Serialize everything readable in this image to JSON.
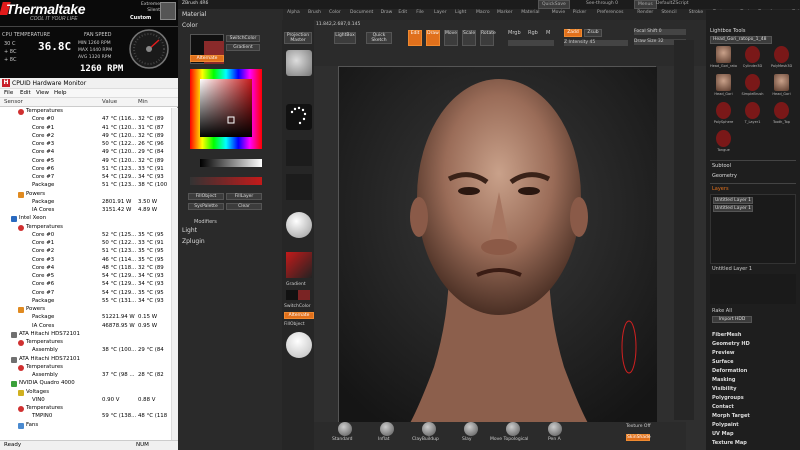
{
  "thermaltake": {
    "brand": "Thermaltake",
    "tagline": "COOL IT YOUR LIFE",
    "profile_line1": "Extreme",
    "profile_line2": "Silent",
    "profile_current": "Custom",
    "cpu_label": "CPU TEMPERATURE",
    "fan_label": "FAN SPEED",
    "cpu_temp": "36.8C",
    "row1": "30 C",
    "row2": "+ 8C",
    "row3": "+ 8C",
    "fan_min": "MIN   1260 RPM",
    "fan_max": "MAX   1440 RPM",
    "fan_avg": "AVG   1320 RPM",
    "rpm": "1260 RPM"
  },
  "hwmonitor": {
    "title": "CPUID Hardware Monitor",
    "menu": [
      "File",
      "Edit",
      "View",
      "Help"
    ],
    "headers": {
      "sensor": "Sensor",
      "value": "Value",
      "min": "Min"
    },
    "rows": [
      {
        "label": "Temperatures",
        "value": "",
        "min": "",
        "indent": 2,
        "icon": "thermometer"
      },
      {
        "label": "Core #0",
        "value": "47 °C (116...",
        "min": "32 °C (89",
        "indent": 4
      },
      {
        "label": "Core #1",
        "value": "41 °C (120...",
        "min": "31 °C (87",
        "indent": 4
      },
      {
        "label": "Core #2",
        "value": "49 °C (120...",
        "min": "32 °C (89",
        "indent": 4
      },
      {
        "label": "Core #3",
        "value": "50 °C (122...",
        "min": "26 °C (96",
        "indent": 4
      },
      {
        "label": "Core #4",
        "value": "49 °C (120...",
        "min": "29 °C (84",
        "indent": 4
      },
      {
        "label": "Core #5",
        "value": "49 °C (120...",
        "min": "32 °C (89",
        "indent": 4
      },
      {
        "label": "Core #6",
        "value": "51 °C (123...",
        "min": "33 °C (91",
        "indent": 4
      },
      {
        "label": "Core #7",
        "value": "54 °C (129...",
        "min": "34 °C (93",
        "indent": 4
      },
      {
        "label": "Package",
        "value": "51 °C (123...",
        "min": "38 °C (100",
        "indent": 4
      },
      {
        "label": "Powers",
        "value": "",
        "min": "",
        "indent": 2,
        "icon": "flame"
      },
      {
        "label": "Package",
        "value": "2801.91 W",
        "min": "3.50 W",
        "indent": 4
      },
      {
        "label": "IA Cores",
        "value": "3151.42 W",
        "min": "4.89 W",
        "indent": 4
      },
      {
        "label": "Intel Xeon",
        "value": "",
        "min": "",
        "indent": 1,
        "icon": "chip"
      },
      {
        "label": "Temperatures",
        "value": "",
        "min": "",
        "indent": 2,
        "icon": "thermometer"
      },
      {
        "label": "Core #0",
        "value": "52 °C (125...",
        "min": "35 °C (95",
        "indent": 4
      },
      {
        "label": "Core #1",
        "value": "50 °C (122...",
        "min": "33 °C (91",
        "indent": 4
      },
      {
        "label": "Core #2",
        "value": "51 °C (123...",
        "min": "35 °C (95",
        "indent": 4
      },
      {
        "label": "Core #3",
        "value": "46 °C (114...",
        "min": "35 °C (95",
        "indent": 4
      },
      {
        "label": "Core #4",
        "value": "48 °C (118...",
        "min": "32 °C (89",
        "indent": 4
      },
      {
        "label": "Core #5",
        "value": "54 °C (129...",
        "min": "34 °C (93",
        "indent": 4
      },
      {
        "label": "Core #6",
        "value": "54 °C (129...",
        "min": "34 °C (93",
        "indent": 4
      },
      {
        "label": "Core #7",
        "value": "54 °C (129...",
        "min": "35 °C (95",
        "indent": 4
      },
      {
        "label": "Package",
        "value": "55 °C (131...",
        "min": "34 °C (93",
        "indent": 4
      },
      {
        "label": "Powers",
        "value": "",
        "min": "",
        "indent": 2,
        "icon": "flame"
      },
      {
        "label": "Package",
        "value": "51221.94 W",
        "min": "0.15 W",
        "indent": 4
      },
      {
        "label": "IA Cores",
        "value": "46878.95 W",
        "min": "0.95 W",
        "indent": 4
      },
      {
        "label": "ATA Hitachi HDS72101",
        "value": "",
        "min": "",
        "indent": 1,
        "icon": "disk"
      },
      {
        "label": "Temperatures",
        "value": "",
        "min": "",
        "indent": 2,
        "icon": "thermometer"
      },
      {
        "label": "Assembly",
        "value": "38 °C (100...",
        "min": "29 °C (84",
        "indent": 4
      },
      {
        "label": "ATA Hitachi HDS72101",
        "value": "",
        "min": "",
        "indent": 1,
        "icon": "disk"
      },
      {
        "label": "Temperatures",
        "value": "",
        "min": "",
        "indent": 2,
        "icon": "thermometer"
      },
      {
        "label": "Assembly",
        "value": "37 °C (98 ...",
        "min": "28 °C (82",
        "indent": 4
      },
      {
        "label": "NVIDIA Quadro 4000",
        "value": "",
        "min": "",
        "indent": 1,
        "icon": "gpu"
      },
      {
        "label": "Voltages",
        "value": "",
        "min": "",
        "indent": 2,
        "icon": "voltage"
      },
      {
        "label": "VIN0",
        "value": "0.90 V",
        "min": "0.88 V",
        "indent": 4
      },
      {
        "label": "Temperatures",
        "value": "",
        "min": "",
        "indent": 2,
        "icon": "thermometer"
      },
      {
        "label": "TMPIN0",
        "value": "59 °C (138...",
        "min": "48 °C (118",
        "indent": 4
      },
      {
        "label": "Fans",
        "value": "",
        "min": "",
        "indent": 2,
        "icon": "fan"
      }
    ],
    "status_ready": "Ready",
    "status_num": "NUM"
  },
  "zbrush": {
    "title": "ZBrush 4R6",
    "menu": [
      "Alpha",
      "Brush",
      "Color",
      "Document",
      "Draw",
      "Edit",
      "File",
      "Layer",
      "Light",
      "Macro",
      "Marker",
      "Material",
      "Movie",
      "Picker",
      "Preferences",
      "Render",
      "Stencil",
      "Stroke",
      "Texture",
      "Tool",
      "Transform",
      "Zplugin",
      "Zscript"
    ],
    "quicksave": "QuickSave",
    "seethrough": "See-through   0",
    "menus": "Menus",
    "defaultzscript": "DefaultZScript",
    "left_material": "Material",
    "left_color": "Color",
    "switchcolor": "SwitchColor",
    "gradient": "Gradient",
    "alternate": "Alternate",
    "fillobject": "FillObject",
    "fillayer": "FillLayer",
    "syspalette": "SysPalette",
    "clear": "Clear",
    "modifiers": "Modifiers",
    "light": "Light",
    "zplugin": "Zplugin",
    "projection_master": "Projection Master",
    "lightbox": "LightBox",
    "quick_sketch": "Quick Sketch",
    "edit": "Edit",
    "draw": "Draw",
    "move": "Move",
    "scale": "Scale",
    "rotate": "Rotate",
    "mrgb": "Mrgb",
    "rgb": "Rgb",
    "m": "M",
    "zadd": "Zadd",
    "zsub": "Zsub",
    "rgb_intensity": "Rgb Intensity",
    "z_intensity": "Z Intensity 45",
    "focal_shift": "Focal Shift 0",
    "draw_size": "Draw Size 32",
    "coord": "11.842,2.687,0.145",
    "brushes": [
      "Standard",
      "Inflat",
      "ClayBuildup",
      "Slay",
      "Move Topological",
      "Pen A"
    ],
    "texture_off": "Texture Off",
    "skinshade": "SkinShade",
    "right_title": "Lightbox Tools",
    "tool_name": "Head_Gori_ratopo_1_48",
    "tool_thumbs": [
      "Head_Gori_ratopo",
      "Cylinder3D",
      "PolyMesh3D",
      "Head_Gori",
      "SimpleBrush",
      "Head_Gori",
      "PolySphere",
      "T_Layer1",
      "Tooth_Top",
      "Tongue"
    ],
    "subtool": "Subtool",
    "geometry": "Geometry",
    "layers": "Layers",
    "untitled_layer": "Untitled Layer 1",
    "rake_all": "Rake All",
    "import_hdd": "Import HDD",
    "right_menu": [
      "FiberMesh",
      "Geometry HD",
      "Preview",
      "Surface",
      "Deformation",
      "Masking",
      "Visibility",
      "Polygroups",
      "Contact",
      "Morph Target",
      "Polypaint",
      "UV Map",
      "Texture Map"
    ],
    "colors": {
      "accent": "#e0701c",
      "bg": "#2f2f2f"
    }
  }
}
